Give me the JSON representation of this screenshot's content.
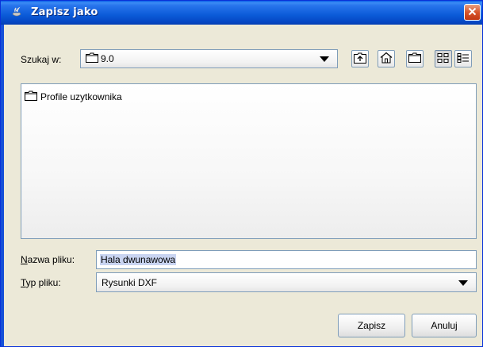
{
  "window": {
    "title": "Zapisz jako"
  },
  "lookin": {
    "label": "Szukaj w:",
    "value": "9.0"
  },
  "toolbar": {
    "icons": [
      "up-folder-icon",
      "home-icon",
      "new-folder-icon",
      "list-view-icon",
      "details-view-icon"
    ]
  },
  "files": [
    {
      "name": "Profile uzytkownika",
      "type": "folder"
    }
  ],
  "filename": {
    "label_mnemonic": "N",
    "label_rest": "azwa pliku:",
    "value": "Hala dwunawowa"
  },
  "filetype": {
    "label_mnemonic": "T",
    "label_rest": "yp pliku:",
    "value": "Rysunki DXF"
  },
  "buttons": {
    "save": "Zapisz",
    "cancel": "Anuluj"
  },
  "colors": {
    "titlebar": "#0A5FE8",
    "dialog_bg": "#ECE9D8",
    "border": "#7F9DB9",
    "close": "#D7552B"
  }
}
